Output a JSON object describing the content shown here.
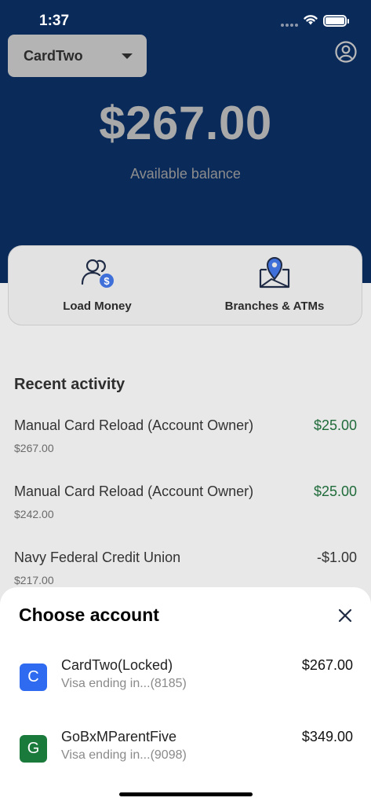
{
  "status_bar": {
    "time": "1:37"
  },
  "header": {
    "card_selector_label": "CardTwo",
    "balance": "$267.00",
    "balance_label": "Available balance"
  },
  "actions": [
    {
      "label": "Load Money",
      "icon": "load-money-icon"
    },
    {
      "label": "Branches & ATMs",
      "icon": "map-pin-icon"
    }
  ],
  "recent_activity": {
    "title": "Recent activity",
    "items": [
      {
        "description": "Manual Card Reload (Account Owner)",
        "amount": "$25.00",
        "balance": "$267.00",
        "type": "credit"
      },
      {
        "description": "Manual Card Reload (Account Owner)",
        "amount": "$25.00",
        "balance": "$242.00",
        "type": "credit"
      },
      {
        "description": "Navy Federal Credit Union",
        "amount": "-$1.00",
        "balance": "$217.00",
        "type": "debit"
      }
    ]
  },
  "sheet": {
    "title": "Choose account",
    "accounts": [
      {
        "initial": "C",
        "name": "CardTwo(Locked)",
        "subtitle": "Visa ending in...(8185)",
        "amount": "$267.00",
        "color": "#2e6bf0"
      },
      {
        "initial": "G",
        "name": "GoBxMParentFive",
        "subtitle": "Visa ending in...(9098)",
        "amount": "$349.00",
        "color": "#1a7a3c"
      }
    ]
  },
  "colors": {
    "header_bg": "#0a2a5a",
    "positive": "#1f6b3a"
  }
}
